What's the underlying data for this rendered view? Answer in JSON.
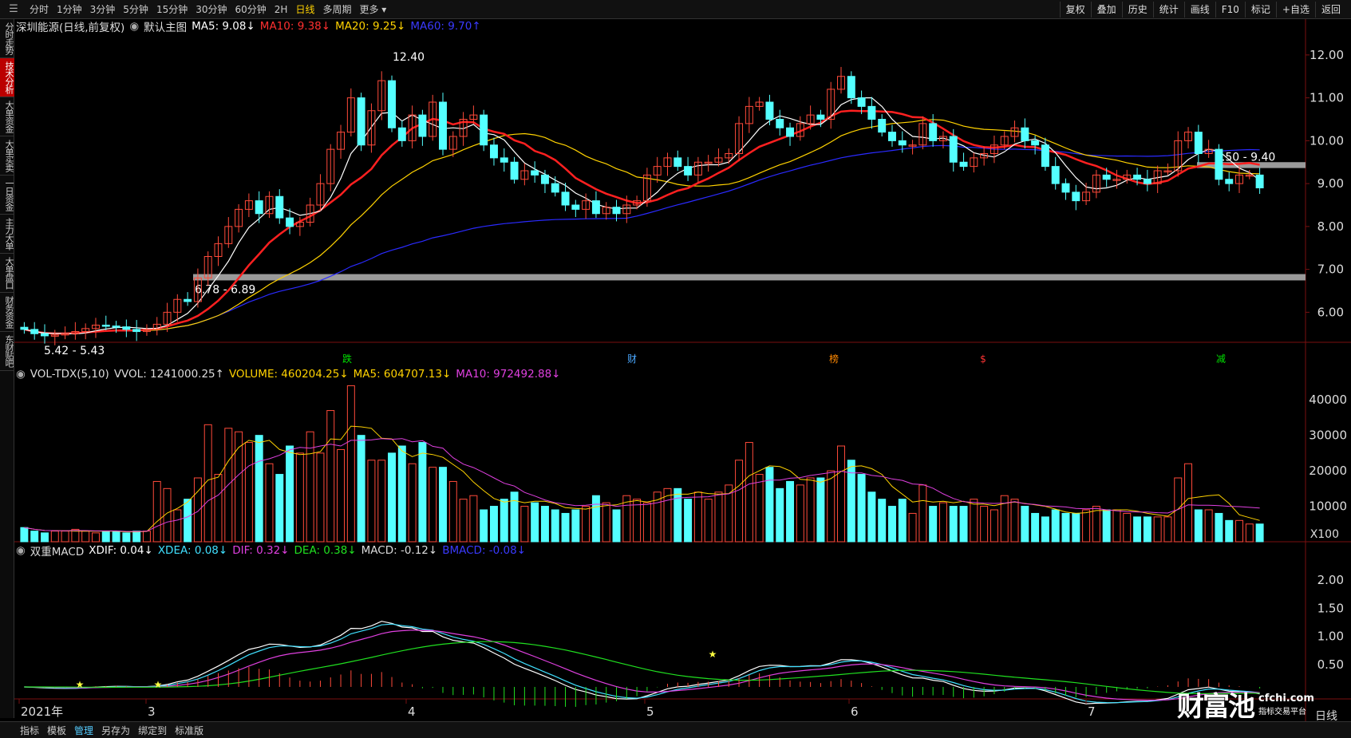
{
  "toolbar": {
    "periods": [
      "分时",
      "1分钟",
      "3分钟",
      "5分钟",
      "15分钟",
      "30分钟",
      "60分钟",
      "2H",
      "日线",
      "多周期",
      "更多 ▾"
    ],
    "active_period": "日线",
    "right_buttons": [
      "复权",
      "叠加",
      "历史",
      "统计",
      "画线",
      "F10",
      "标记",
      "+自选",
      "返回"
    ]
  },
  "sidebar": {
    "items": [
      "分时走势",
      "技术分析",
      "大单资金",
      "大单买卖",
      "一日资金",
      "主力大单",
      "大单盘口",
      "财务资金",
      "东财贴吧"
    ],
    "active": "技术分析"
  },
  "main_panel": {
    "stock": "深圳能源(日线,前复权)",
    "template": "默认主图",
    "ma5": "MA5: 9.08↓",
    "ma10": "MA10: 9.38↓",
    "ma20": "MA20: 9.25↓",
    "ma60": "MA60: 9.70↑",
    "y_ticks": [
      "12.00",
      "11.00",
      "10.00",
      "9.00",
      "8.00",
      "7.00",
      "6.00"
    ],
    "high_label": "12.40",
    "low_label": "5.42 - 5.43",
    "zone1_label": "6.78 - 6.89",
    "zone2_label": "9.50 - 9.40",
    "events": [
      {
        "text": "跌",
        "color": "#00e000"
      },
      {
        "text": "财",
        "color": "#4aa8ff"
      },
      {
        "text": "榜",
        "color": "#ff8800"
      },
      {
        "text": "$",
        "color": "#ff3333"
      },
      {
        "text": "减",
        "color": "#00e000"
      }
    ],
    "colors": {
      "up": "#ff4a3a",
      "down": "#54ffff",
      "ma5": "#ffffff",
      "ma10": "#ff2020",
      "ma20": "#ffd200",
      "ma60": "#2a2aff"
    }
  },
  "volume_panel": {
    "title": "VOL-TDX(5,10)",
    "vvol": "VVOL: 1241000.25↑",
    "volume": "VOLUME: 460204.25↓",
    "ma5": "MA5: 604707.13↓",
    "ma10": "MA10: 972492.88↓",
    "y_ticks": [
      "40000",
      "30000",
      "20000",
      "10000"
    ],
    "unit": "X100"
  },
  "macd_panel": {
    "title": "双重MACD",
    "xdif": "XDIF: 0.04↓",
    "xdea": "XDEA: 0.08↓",
    "dif": "DIF: 0.32↓",
    "dea": "DEA: 0.38↓",
    "macd": "MACD: -0.12↓",
    "bmacd": "BMACD: -0.08↓",
    "y_ticks": [
      "2.00",
      "1.50",
      "1.00",
      "0.50"
    ]
  },
  "x_axis": {
    "labels": [
      "2021年",
      "3",
      "4",
      "5",
      "6",
      "7"
    ],
    "period_label": "日线"
  },
  "bottom_bar": {
    "items": [
      "指标",
      "模板",
      "管理",
      "另存为",
      "绑定到",
      "标准版"
    ],
    "active": "管理"
  },
  "watermark": {
    "big": "财富池",
    "url": "cfchi.com",
    "tagline": "指标交易平台"
  },
  "chart_data": {
    "type": "candlestick",
    "closes": [
      5.6,
      5.5,
      5.45,
      5.47,
      5.5,
      5.55,
      5.62,
      5.7,
      5.68,
      5.66,
      5.6,
      5.55,
      5.6,
      5.72,
      6.0,
      6.3,
      6.25,
      6.8,
      7.3,
      7.6,
      8.0,
      8.4,
      8.6,
      8.3,
      8.7,
      8.2,
      8.0,
      8.1,
      8.5,
      9.0,
      9.8,
      10.2,
      11.0,
      9.9,
      10.7,
      11.4,
      10.3,
      10.0,
      10.6,
      10.1,
      10.9,
      9.8,
      10.1,
      10.5,
      10.6,
      9.9,
      9.6,
      9.5,
      9.1,
      9.3,
      9.2,
      9.0,
      8.8,
      8.5,
      8.4,
      8.6,
      8.3,
      8.45,
      8.3,
      8.5,
      8.6,
      9.2,
      9.4,
      9.6,
      9.4,
      9.2,
      9.5,
      9.5,
      9.6,
      9.7,
      10.4,
      10.8,
      10.9,
      10.5,
      10.3,
      10.1,
      10.4,
      10.6,
      10.5,
      11.2,
      11.5,
      11.0,
      10.8,
      10.5,
      10.2,
      10.0,
      9.9,
      9.9,
      10.4,
      10.0,
      10.1,
      9.5,
      9.4,
      9.6,
      9.7,
      9.9,
      10.1,
      10.3,
      10.0,
      9.9,
      9.4,
      9.0,
      8.8,
      8.6,
      8.8,
      9.2,
      9.1,
      9.1,
      9.2,
      9.1,
      9.0,
      9.3,
      9.3,
      10.0,
      10.2,
      9.7,
      9.8,
      9.1,
      9.0,
      9.2,
      9.2,
      8.9
    ],
    "opens": [
      5.65,
      5.6,
      5.5,
      5.45,
      5.47,
      5.5,
      5.55,
      5.62,
      5.7,
      5.68,
      5.66,
      5.6,
      5.55,
      5.6,
      5.72,
      6.0,
      6.3,
      6.25,
      6.8,
      7.3,
      7.6,
      8.0,
      8.4,
      8.6,
      8.3,
      8.7,
      8.2,
      8.0,
      8.1,
      8.5,
      9.0,
      9.8,
      10.2,
      11.0,
      9.9,
      10.7,
      11.4,
      10.3,
      10.0,
      10.6,
      10.1,
      10.9,
      9.8,
      10.1,
      10.5,
      10.6,
      9.9,
      9.6,
      9.5,
      9.1,
      9.3,
      9.2,
      9.0,
      8.8,
      8.5,
      8.4,
      8.6,
      8.3,
      8.45,
      8.3,
      8.5,
      8.6,
      9.2,
      9.4,
      9.6,
      9.4,
      9.2,
      9.5,
      9.5,
      9.6,
      9.7,
      10.4,
      10.8,
      10.9,
      10.5,
      10.3,
      10.1,
      10.4,
      10.6,
      10.5,
      11.2,
      11.5,
      11.0,
      10.8,
      10.5,
      10.2,
      10.0,
      9.9,
      9.9,
      10.4,
      10.0,
      10.1,
      9.5,
      9.4,
      9.6,
      9.7,
      9.9,
      10.1,
      10.3,
      10.0,
      9.9,
      9.4,
      9.0,
      8.8,
      8.6,
      8.8,
      9.2,
      9.1,
      9.1,
      9.2,
      9.1,
      9.0,
      9.3,
      9.3,
      10.0,
      10.2,
      9.7,
      9.8,
      9.1,
      9.0,
      9.2,
      9.2
    ],
    "volumes": [
      4,
      3,
      2.5,
      3,
      3,
      3.5,
      3,
      2.5,
      3,
      3,
      2.5,
      3,
      3,
      17,
      15,
      9,
      12,
      18,
      33,
      19,
      32,
      31,
      28,
      30,
      22,
      19,
      27,
      25,
      31,
      25,
      37,
      26,
      44,
      30,
      23,
      23,
      25,
      27,
      22,
      28,
      21,
      21,
      17,
      12,
      13,
      9,
      10,
      12,
      14,
      10,
      11,
      10,
      9,
      8,
      9,
      10,
      13,
      11,
      9,
      13,
      12,
      11,
      14,
      15,
      15,
      12,
      14,
      12,
      14,
      16,
      23,
      28,
      19,
      21,
      15,
      17,
      16,
      18,
      18,
      20,
      27,
      23,
      19,
      14,
      12,
      10,
      12,
      8,
      16,
      10,
      11,
      10,
      10,
      12,
      10,
      9,
      13,
      12,
      10,
      8,
      7,
      9,
      8,
      8,
      9,
      10,
      9,
      9,
      8,
      7,
      7,
      7,
      7,
      18,
      22,
      9,
      9,
      8,
      6,
      6,
      5,
      5
    ],
    "y_range": [
      5.3,
      12.5
    ],
    "vol_range": [
      0,
      45000
    ],
    "macd_range": [
      0,
      2.4
    ]
  }
}
